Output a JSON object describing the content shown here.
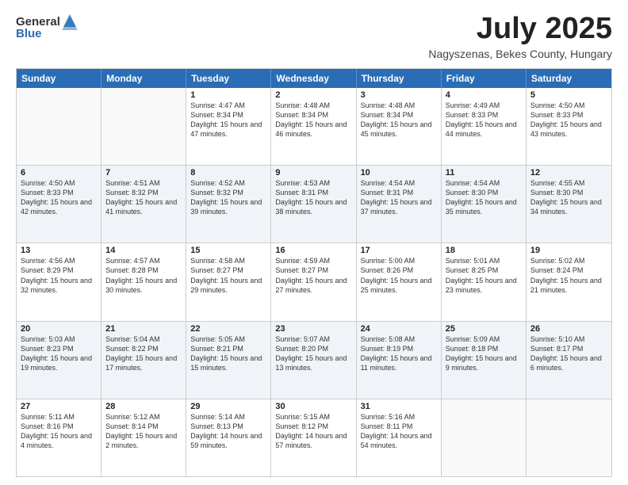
{
  "header": {
    "logo_general": "General",
    "logo_blue": "Blue",
    "title": "July 2025",
    "subtitle": "Nagyszenas, Bekes County, Hungary"
  },
  "days_of_week": [
    "Sunday",
    "Monday",
    "Tuesday",
    "Wednesday",
    "Thursday",
    "Friday",
    "Saturday"
  ],
  "weeks": [
    [
      {
        "day": "",
        "sunrise": "",
        "sunset": "",
        "daylight": "",
        "empty": true
      },
      {
        "day": "",
        "sunrise": "",
        "sunset": "",
        "daylight": "",
        "empty": true
      },
      {
        "day": "1",
        "sunrise": "Sunrise: 4:47 AM",
        "sunset": "Sunset: 8:34 PM",
        "daylight": "Daylight: 15 hours and 47 minutes.",
        "empty": false
      },
      {
        "day": "2",
        "sunrise": "Sunrise: 4:48 AM",
        "sunset": "Sunset: 8:34 PM",
        "daylight": "Daylight: 15 hours and 46 minutes.",
        "empty": false
      },
      {
        "day": "3",
        "sunrise": "Sunrise: 4:48 AM",
        "sunset": "Sunset: 8:34 PM",
        "daylight": "Daylight: 15 hours and 45 minutes.",
        "empty": false
      },
      {
        "day": "4",
        "sunrise": "Sunrise: 4:49 AM",
        "sunset": "Sunset: 8:33 PM",
        "daylight": "Daylight: 15 hours and 44 minutes.",
        "empty": false
      },
      {
        "day": "5",
        "sunrise": "Sunrise: 4:50 AM",
        "sunset": "Sunset: 8:33 PM",
        "daylight": "Daylight: 15 hours and 43 minutes.",
        "empty": false
      }
    ],
    [
      {
        "day": "6",
        "sunrise": "Sunrise: 4:50 AM",
        "sunset": "Sunset: 8:33 PM",
        "daylight": "Daylight: 15 hours and 42 minutes.",
        "empty": false
      },
      {
        "day": "7",
        "sunrise": "Sunrise: 4:51 AM",
        "sunset": "Sunset: 8:32 PM",
        "daylight": "Daylight: 15 hours and 41 minutes.",
        "empty": false
      },
      {
        "day": "8",
        "sunrise": "Sunrise: 4:52 AM",
        "sunset": "Sunset: 8:32 PM",
        "daylight": "Daylight: 15 hours and 39 minutes.",
        "empty": false
      },
      {
        "day": "9",
        "sunrise": "Sunrise: 4:53 AM",
        "sunset": "Sunset: 8:31 PM",
        "daylight": "Daylight: 15 hours and 38 minutes.",
        "empty": false
      },
      {
        "day": "10",
        "sunrise": "Sunrise: 4:54 AM",
        "sunset": "Sunset: 8:31 PM",
        "daylight": "Daylight: 15 hours and 37 minutes.",
        "empty": false
      },
      {
        "day": "11",
        "sunrise": "Sunrise: 4:54 AM",
        "sunset": "Sunset: 8:30 PM",
        "daylight": "Daylight: 15 hours and 35 minutes.",
        "empty": false
      },
      {
        "day": "12",
        "sunrise": "Sunrise: 4:55 AM",
        "sunset": "Sunset: 8:30 PM",
        "daylight": "Daylight: 15 hours and 34 minutes.",
        "empty": false
      }
    ],
    [
      {
        "day": "13",
        "sunrise": "Sunrise: 4:56 AM",
        "sunset": "Sunset: 8:29 PM",
        "daylight": "Daylight: 15 hours and 32 minutes.",
        "empty": false
      },
      {
        "day": "14",
        "sunrise": "Sunrise: 4:57 AM",
        "sunset": "Sunset: 8:28 PM",
        "daylight": "Daylight: 15 hours and 30 minutes.",
        "empty": false
      },
      {
        "day": "15",
        "sunrise": "Sunrise: 4:58 AM",
        "sunset": "Sunset: 8:27 PM",
        "daylight": "Daylight: 15 hours and 29 minutes.",
        "empty": false
      },
      {
        "day": "16",
        "sunrise": "Sunrise: 4:59 AM",
        "sunset": "Sunset: 8:27 PM",
        "daylight": "Daylight: 15 hours and 27 minutes.",
        "empty": false
      },
      {
        "day": "17",
        "sunrise": "Sunrise: 5:00 AM",
        "sunset": "Sunset: 8:26 PM",
        "daylight": "Daylight: 15 hours and 25 minutes.",
        "empty": false
      },
      {
        "day": "18",
        "sunrise": "Sunrise: 5:01 AM",
        "sunset": "Sunset: 8:25 PM",
        "daylight": "Daylight: 15 hours and 23 minutes.",
        "empty": false
      },
      {
        "day": "19",
        "sunrise": "Sunrise: 5:02 AM",
        "sunset": "Sunset: 8:24 PM",
        "daylight": "Daylight: 15 hours and 21 minutes.",
        "empty": false
      }
    ],
    [
      {
        "day": "20",
        "sunrise": "Sunrise: 5:03 AM",
        "sunset": "Sunset: 8:23 PM",
        "daylight": "Daylight: 15 hours and 19 minutes.",
        "empty": false
      },
      {
        "day": "21",
        "sunrise": "Sunrise: 5:04 AM",
        "sunset": "Sunset: 8:22 PM",
        "daylight": "Daylight: 15 hours and 17 minutes.",
        "empty": false
      },
      {
        "day": "22",
        "sunrise": "Sunrise: 5:05 AM",
        "sunset": "Sunset: 8:21 PM",
        "daylight": "Daylight: 15 hours and 15 minutes.",
        "empty": false
      },
      {
        "day": "23",
        "sunrise": "Sunrise: 5:07 AM",
        "sunset": "Sunset: 8:20 PM",
        "daylight": "Daylight: 15 hours and 13 minutes.",
        "empty": false
      },
      {
        "day": "24",
        "sunrise": "Sunrise: 5:08 AM",
        "sunset": "Sunset: 8:19 PM",
        "daylight": "Daylight: 15 hours and 11 minutes.",
        "empty": false
      },
      {
        "day": "25",
        "sunrise": "Sunrise: 5:09 AM",
        "sunset": "Sunset: 8:18 PM",
        "daylight": "Daylight: 15 hours and 9 minutes.",
        "empty": false
      },
      {
        "day": "26",
        "sunrise": "Sunrise: 5:10 AM",
        "sunset": "Sunset: 8:17 PM",
        "daylight": "Daylight: 15 hours and 6 minutes.",
        "empty": false
      }
    ],
    [
      {
        "day": "27",
        "sunrise": "Sunrise: 5:11 AM",
        "sunset": "Sunset: 8:16 PM",
        "daylight": "Daylight: 15 hours and 4 minutes.",
        "empty": false
      },
      {
        "day": "28",
        "sunrise": "Sunrise: 5:12 AM",
        "sunset": "Sunset: 8:14 PM",
        "daylight": "Daylight: 15 hours and 2 minutes.",
        "empty": false
      },
      {
        "day": "29",
        "sunrise": "Sunrise: 5:14 AM",
        "sunset": "Sunset: 8:13 PM",
        "daylight": "Daylight: 14 hours and 59 minutes.",
        "empty": false
      },
      {
        "day": "30",
        "sunrise": "Sunrise: 5:15 AM",
        "sunset": "Sunset: 8:12 PM",
        "daylight": "Daylight: 14 hours and 57 minutes.",
        "empty": false
      },
      {
        "day": "31",
        "sunrise": "Sunrise: 5:16 AM",
        "sunset": "Sunset: 8:11 PM",
        "daylight": "Daylight: 14 hours and 54 minutes.",
        "empty": false
      },
      {
        "day": "",
        "sunrise": "",
        "sunset": "",
        "daylight": "",
        "empty": true
      },
      {
        "day": "",
        "sunrise": "",
        "sunset": "",
        "daylight": "",
        "empty": true
      }
    ]
  ]
}
